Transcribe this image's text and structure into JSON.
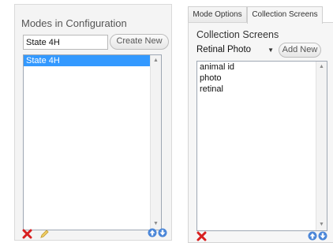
{
  "left_panel": {
    "title": "Modes in Configuration",
    "mode_name_value": "State 4H",
    "create_button": "Create New",
    "modes": [
      {
        "label": "State 4H",
        "selected": true
      }
    ]
  },
  "tabs": [
    {
      "label": "Mode Options",
      "active": false
    },
    {
      "label": "Collection Screens",
      "active": true
    }
  ],
  "right_panel": {
    "title": "Collection Screens",
    "screen_type_selected": "Retinal Photo",
    "add_button": "Add New",
    "screens": [
      "animal id",
      "photo",
      "retinal"
    ]
  },
  "icons": {
    "delete": "red-x-icon",
    "edit": "pencil-icon",
    "move_up": "blue-up-arrow-icon",
    "move_down": "blue-down-arrow-icon"
  },
  "colors": {
    "selection": "#3399ff",
    "delete_red": "#d82020",
    "arrow_blue": "#4a86d8"
  }
}
